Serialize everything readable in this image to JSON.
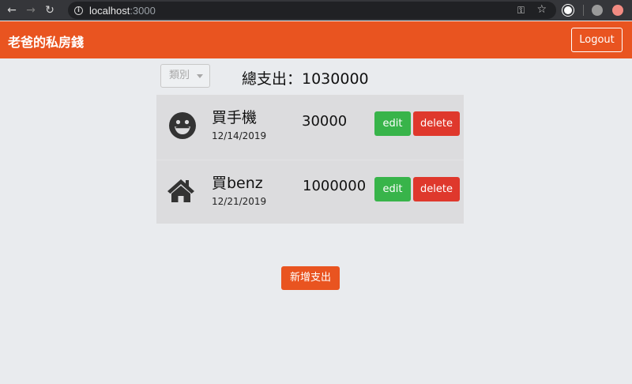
{
  "browser": {
    "url_host": "localhost",
    "url_port": ":3000",
    "icons": {
      "back": "arrow-left-icon",
      "forward": "arrow-right-icon",
      "reload": "reload-icon",
      "info": "info-icon",
      "key": "key-icon",
      "star": "star-icon"
    }
  },
  "navbar": {
    "brand": "老爸的私房錢",
    "logout_label": "Logout",
    "color": "#e95420"
  },
  "filter": {
    "selected": "類別"
  },
  "total": {
    "text": "總支出：1030000"
  },
  "records": [
    {
      "icon": "grin-icon",
      "name": "買手機",
      "date": "12/14/2019",
      "amount": "30000",
      "edit_label": "edit",
      "delete_label": "delete"
    },
    {
      "icon": "home-icon",
      "name": "買benz",
      "date": "12/21/2019",
      "amount": "1000000",
      "edit_label": "edit",
      "delete_label": "delete"
    }
  ],
  "add_button": {
    "label": "新增支出"
  },
  "colors": {
    "edit": "#38b44a",
    "delete": "#df382c",
    "background": "#e9ebee"
  }
}
